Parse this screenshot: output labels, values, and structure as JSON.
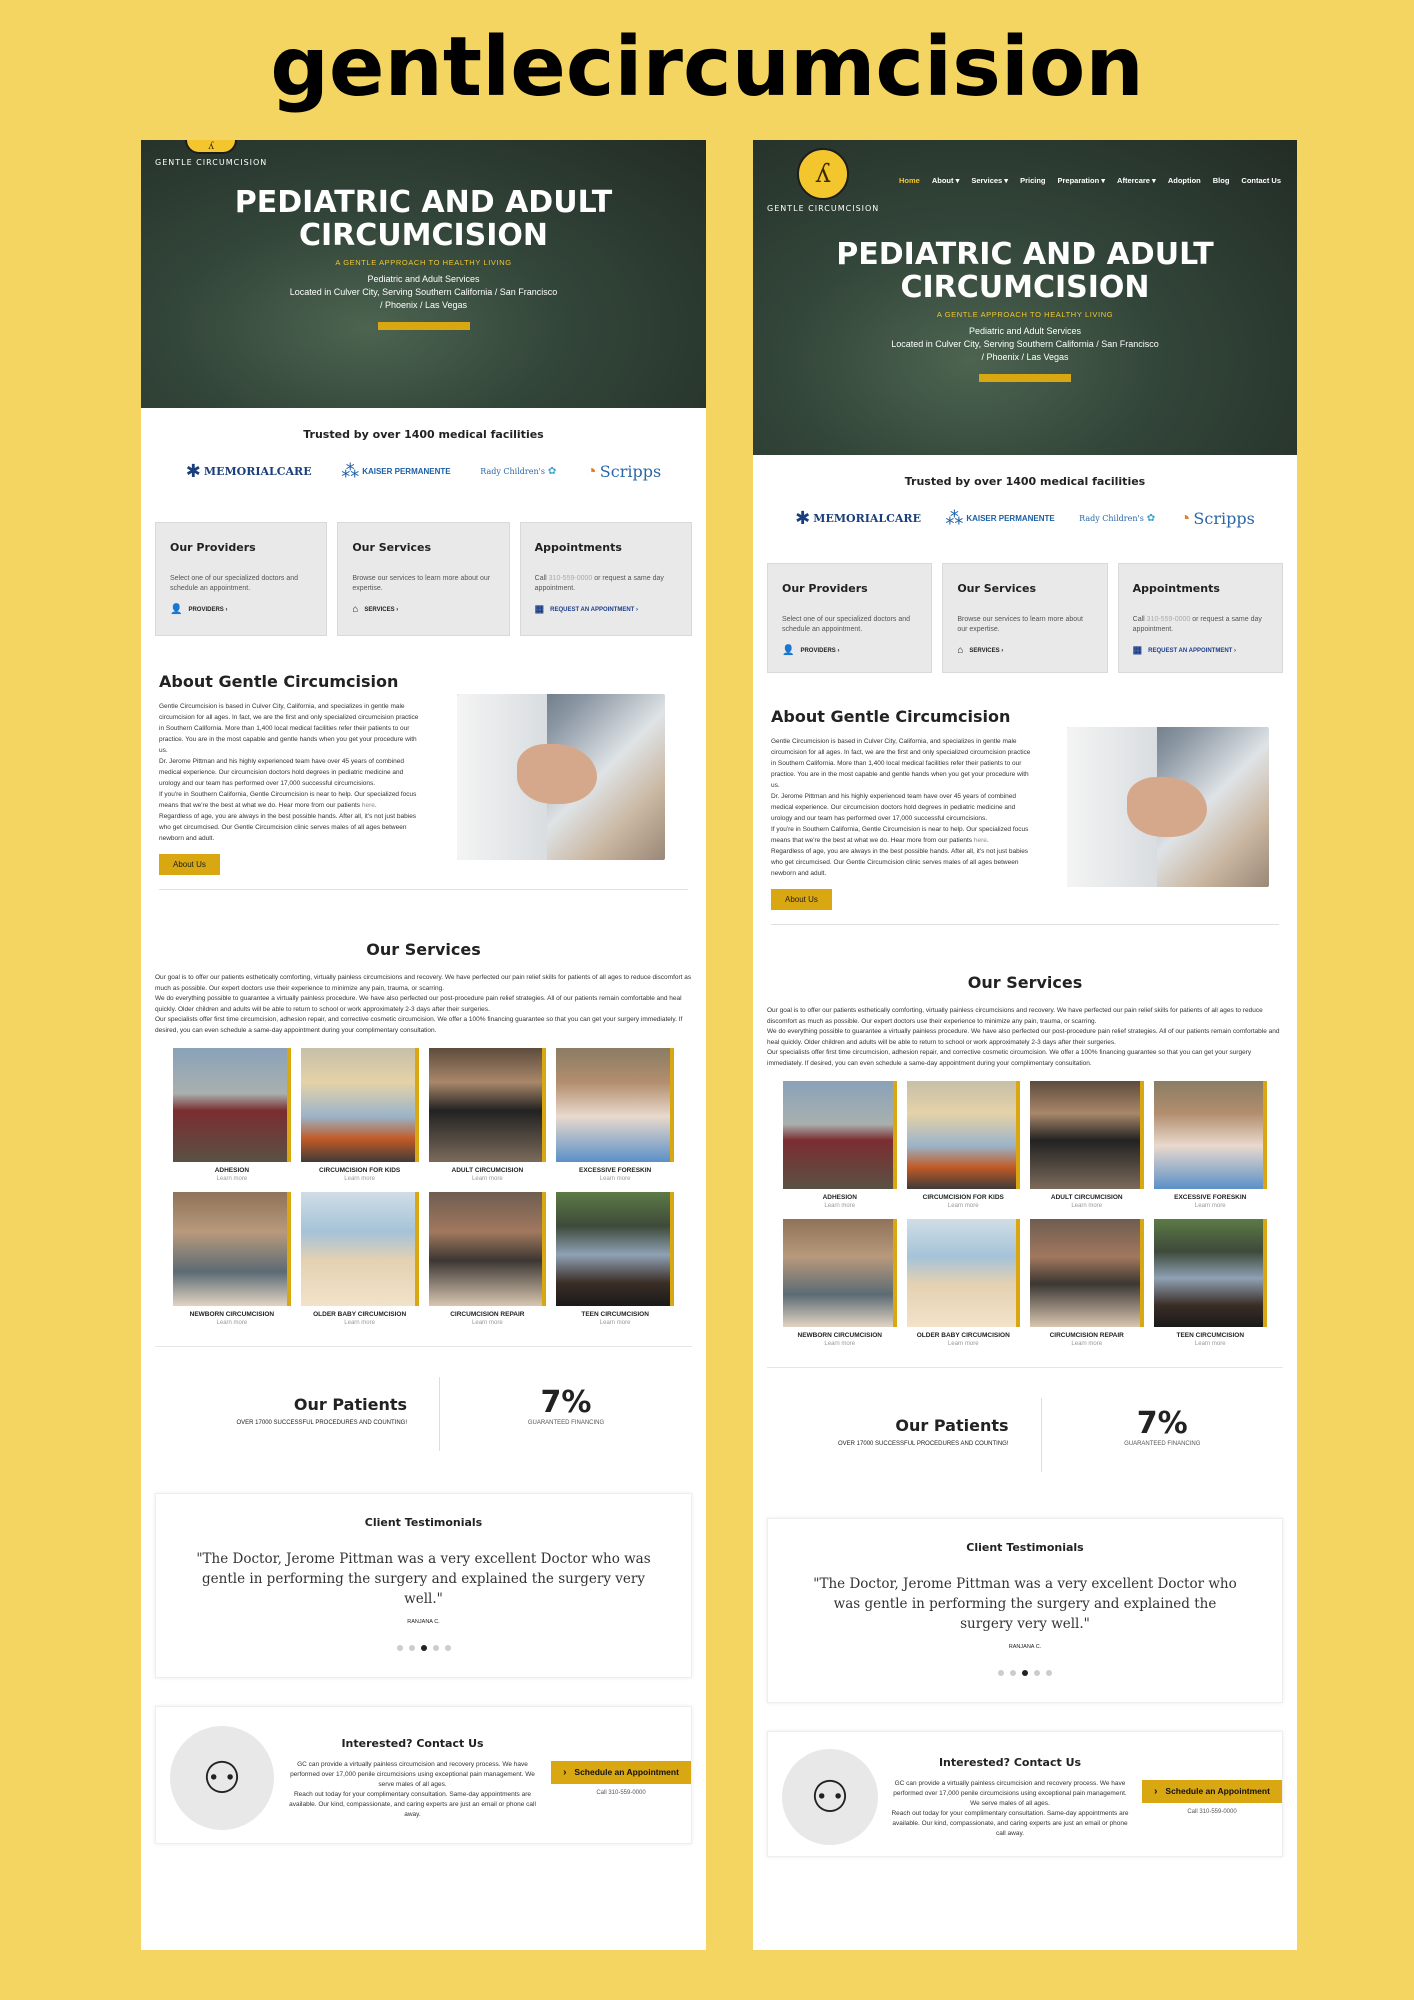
{
  "banner": {
    "title": "gentlecircumcision"
  },
  "site": {
    "logo_text": "GENTLE CIRCUMCISION",
    "nav": [
      "Home",
      "About ▾",
      "Services ▾",
      "Pricing",
      "Preparation ▾",
      "Aftercare ▾",
      "Adoption",
      "Blog",
      "Contact Us"
    ],
    "hero": {
      "title": "PEDIATRIC AND ADULT CIRCUMCISION",
      "tagline": "A GENTLE APPROACH TO HEALTHY LIVING",
      "subtitle": "Pediatric and Adult Services",
      "location": "Located in Culver City, Serving Southern California / San Francisco / Phoenix / Las Vegas"
    },
    "trusted": {
      "title": "Trusted by over 1400 medical facilities",
      "logos": [
        "MEMORIALCARE",
        "KAISER PERMANENTE",
        "Rady Children's",
        "Scripps"
      ]
    },
    "cards": [
      {
        "title": "Our Providers",
        "text": "Select one of our specialized doctors and schedule an appointment.",
        "link": "PROVIDERS ›",
        "icon": "👤"
      },
      {
        "title": "Our Services",
        "text": "Browse our services to learn more about our expertise.",
        "link": "SERVICES ›",
        "icon": "⌂"
      },
      {
        "title": "Appointments",
        "text_before": "Call ",
        "phone": "310-559-0000",
        "text_after": " or request a same day appointment.",
        "link": "REQUEST AN APPOINTMENT ›",
        "icon": "▦"
      }
    ],
    "about": {
      "title": "About Gentle Circumcision",
      "p1": "Gentle Circumcision is based in Culver City, California, and specializes in gentle male circumcision for all ages. In fact, we are the first and only specialized circumcision practice in Southern California. More than 1,400 local medical facilities refer their patients to our practice. You are in the most capable and gentle hands when you get your procedure with us.",
      "p2": "Dr. Jerome Pittman and his highly experienced team have over 45 years of combined medical experience. Our circumcision doctors hold degrees in pediatric medicine and urology and our team has performed over 17,000 successful circumcisions.",
      "p3_before": "If you're in Southern California, Gentle Circumcision is near to help. Our specialized focus means that we're the best at what we do. Hear more from our patients ",
      "p3_link": "here",
      "p3_after": ".",
      "p4": "Regardless of age, you are always in the best possible hands. After all, it's not just babies who get circumcised. Our Gentle Circumcision clinic serves males of all ages between newborn and adult.",
      "button": "About Us"
    },
    "services": {
      "title": "Our Services",
      "intro1": "Our goal is to offer our patients esthetically comforting, virtually painless circumcisions and recovery. We have perfected our pain relief skills for patients of all ages to reduce discomfort as much as possible. Our expert doctors use their experience to minimize any pain, trauma, or scarring.",
      "intro2": "We do everything possible to guarantee a virtually painless procedure. We have also perfected our post-procedure pain relief strategies. All of our patients remain comfortable and heal quickly. Older children and adults will be able to return to school or work approximately 2-3 days after their surgeries.",
      "intro3": "Our specialists offer first time circumcision, adhesion repair, and corrective cosmetic circumcision. We offer a 100% financing guarantee so that you can get your surgery immediately. If desired, you can even schedule a same-day appointment during your complimentary consultation.",
      "items": [
        {
          "name": "ADHESION",
          "more": "Learn more"
        },
        {
          "name": "CIRCUMCISION FOR KIDS",
          "more": "Learn more"
        },
        {
          "name": "ADULT CIRCUMCISION",
          "more": "Learn more"
        },
        {
          "name": "EXCESSIVE FORESKIN",
          "more": "Learn more"
        },
        {
          "name": "NEWBORN CIRCUMCISION",
          "more": "Learn more"
        },
        {
          "name": "OLDER BABY CIRCUMCISION",
          "more": "Learn more"
        },
        {
          "name": "CIRCUMCISION REPAIR",
          "more": "Learn more"
        },
        {
          "name": "TEEN CIRCUMCISION",
          "more": "Learn more"
        }
      ]
    },
    "patients": {
      "title": "Our Patients",
      "sub": "OVER 17000 SUCCESSFUL PROCEDURES AND COUNTING!",
      "stat": "7%",
      "stat_label": "GUARANTEED FINANCING"
    },
    "testimonials": {
      "title": "Client Testimonials",
      "quote": "\"The Doctor, Jerome Pittman was a very excellent Doctor who was gentle in performing the surgery and explained the surgery very well.\"",
      "author": "RANJANA C."
    },
    "contact": {
      "title": "Interested? Contact Us",
      "p1": "GC can provide a virtually painless circumcision and recovery process. We have performed over 17,000 penile circumcisions using exceptional pain management. We serve males of all ages.",
      "p2": "Reach out today for your complimentary consultation. Same-day appointments are available. Our kind, compassionate, and caring experts are just an email or phone call away.",
      "button": "Schedule an Appointment",
      "call": "Call 310-559-0000"
    }
  },
  "colors": {
    "background": "#f4d561",
    "accent": "#d9a712",
    "hero": "#2c3a30"
  }
}
